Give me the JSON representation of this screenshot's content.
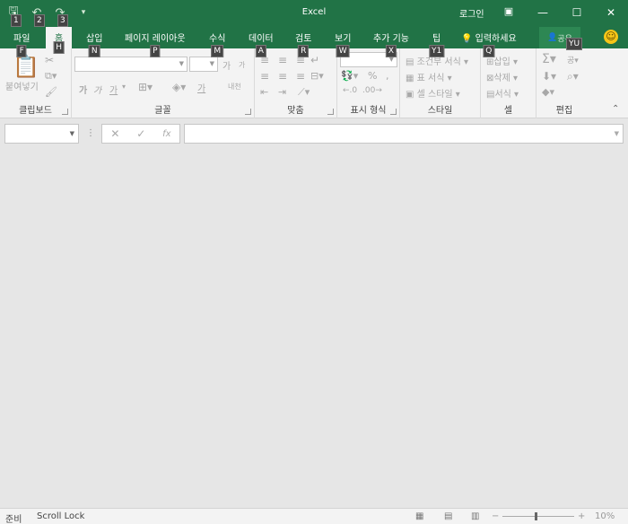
{
  "title_bar": {
    "app_title": "Excel",
    "login_label": "로그인",
    "qat": [
      {
        "icon": "save-icon",
        "glyph": "🖫",
        "keytip": "1"
      },
      {
        "icon": "undo-icon",
        "glyph": "↶",
        "keytip": "2"
      },
      {
        "icon": "redo-icon",
        "glyph": "↷",
        "keytip": "3"
      },
      {
        "icon": "customize-qat-icon",
        "glyph": "▾",
        "keytip": ""
      }
    ],
    "window_buttons": {
      "minimize": "—",
      "maximize": "☐",
      "close": "✕"
    },
    "ribbon_display_icon": "▣"
  },
  "tabs": [
    {
      "label": "파일",
      "keytip": "F"
    },
    {
      "label": "홈",
      "keytip": "H"
    },
    {
      "label": "삽입",
      "keytip": "N"
    },
    {
      "label": "페이지 레이아웃",
      "keytip": "P"
    },
    {
      "label": "수식",
      "keytip": "M"
    },
    {
      "label": "데이터",
      "keytip": "A"
    },
    {
      "label": "검토",
      "keytip": "R"
    },
    {
      "label": "보기",
      "keytip": "W"
    },
    {
      "label": "추가 기능",
      "keytip": "X"
    },
    {
      "label": "팁",
      "keytip": "Y1"
    },
    {
      "label": "입력하세요",
      "keytip": "Q"
    }
  ],
  "share": {
    "label": "공유",
    "keytip": "YU"
  },
  "ribbon": {
    "clipboard": {
      "label": "클립보드",
      "paste": "붙여넣기"
    },
    "font": {
      "label": "글꼴",
      "font_name": "",
      "font_size": "",
      "grow": "가",
      "shrink": "가",
      "bold": "가",
      "italic": "가",
      "underline": "가",
      "font_color": "가",
      "phonetic": "내천"
    },
    "alignment": {
      "label": "맞춤"
    },
    "number": {
      "label": "표시 형식",
      "percent": "%",
      "comma": ","
    },
    "styles": {
      "label": "스타일",
      "conditional": "조건부 서식",
      "table": "표 서식",
      "cell_style": "셀 스타일"
    },
    "cells": {
      "label": "셀",
      "insert": "삽입",
      "delete": "삭제",
      "format": "서식"
    },
    "editing": {
      "label": "편집",
      "sum": "Σ",
      "sort": "공",
      "find": "⌕",
      "clear": "◆"
    }
  },
  "formula_bar": {
    "name_box": "",
    "cancel": "✕",
    "enter": "✓",
    "fx": "fx",
    "formula": ""
  },
  "status_bar": {
    "ready": "준비",
    "scroll_lock": "Scroll Lock",
    "zoom": "10%",
    "zoom_minus": "−",
    "zoom_plus": "+"
  },
  "colors": {
    "accent": "#217346",
    "ribbon_bg": "#f3f3f3",
    "workspace_bg": "#e6e6e6"
  }
}
